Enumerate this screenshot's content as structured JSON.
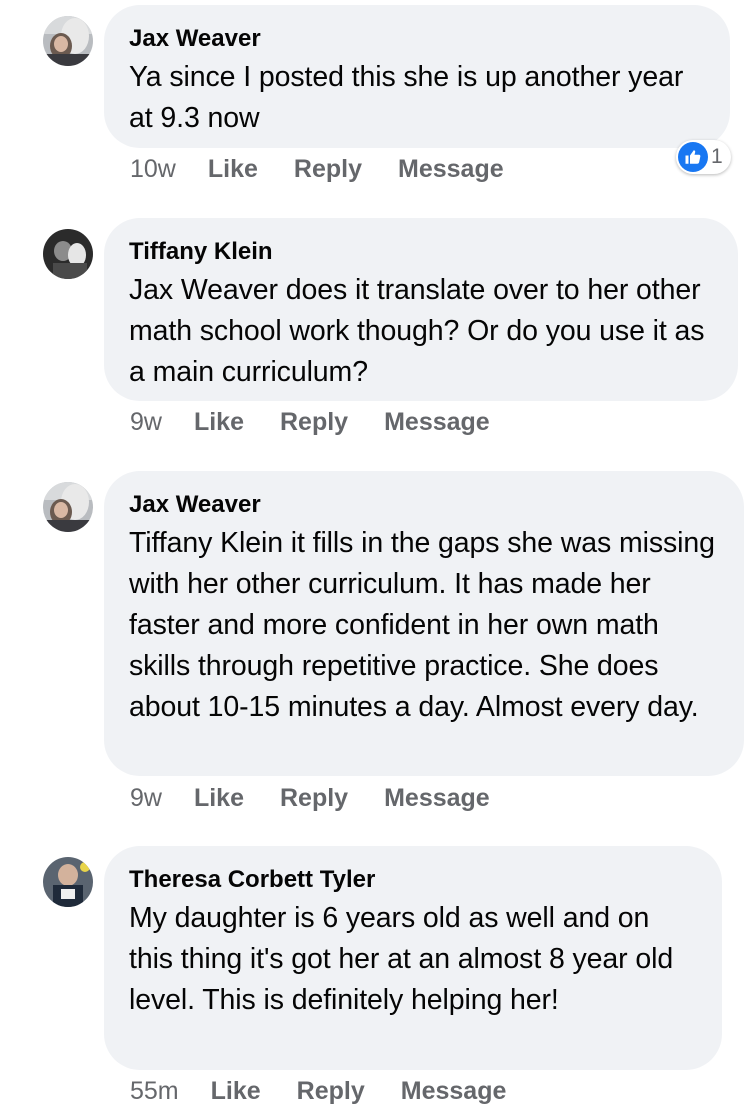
{
  "comments": [
    {
      "author": "Jax Weaver",
      "text": "Ya since I posted this she is up another year at 9.3 now",
      "time": "10w",
      "like_label": "Like",
      "reply_label": "Reply",
      "message_label": "Message",
      "reaction_count": "1",
      "reaction_icon": "thumbs-up-icon"
    },
    {
      "author": "Tiffany Klein",
      "text": "Jax Weaver does it translate over to her other math school work though? Or do you use it as a main curriculum?",
      "time": "9w",
      "like_label": "Like",
      "reply_label": "Reply",
      "message_label": "Message"
    },
    {
      "author": "Jax Weaver",
      "text": "Tiffany Klein it fills in the gaps she was missing with her other curriculum. It has made her faster and more confident in her own math skills through repetitive practice. She does about 10-15 minutes a day. Almost every day.",
      "time": "9w",
      "like_label": "Like",
      "reply_label": "Reply",
      "message_label": "Message"
    },
    {
      "author": "Theresa Corbett Tyler",
      "text": "My daughter is 6 years old as well and on this thing it's got her at an almost 8 year old level. This is definitely helping her!",
      "time": "55m",
      "like_label": "Like",
      "reply_label": "Reply",
      "message_label": "Message"
    }
  ],
  "colors": {
    "bubble": "#f0f2f5",
    "meta_text": "#65676b",
    "like_blue": "#1877f2",
    "text": "#050505"
  }
}
